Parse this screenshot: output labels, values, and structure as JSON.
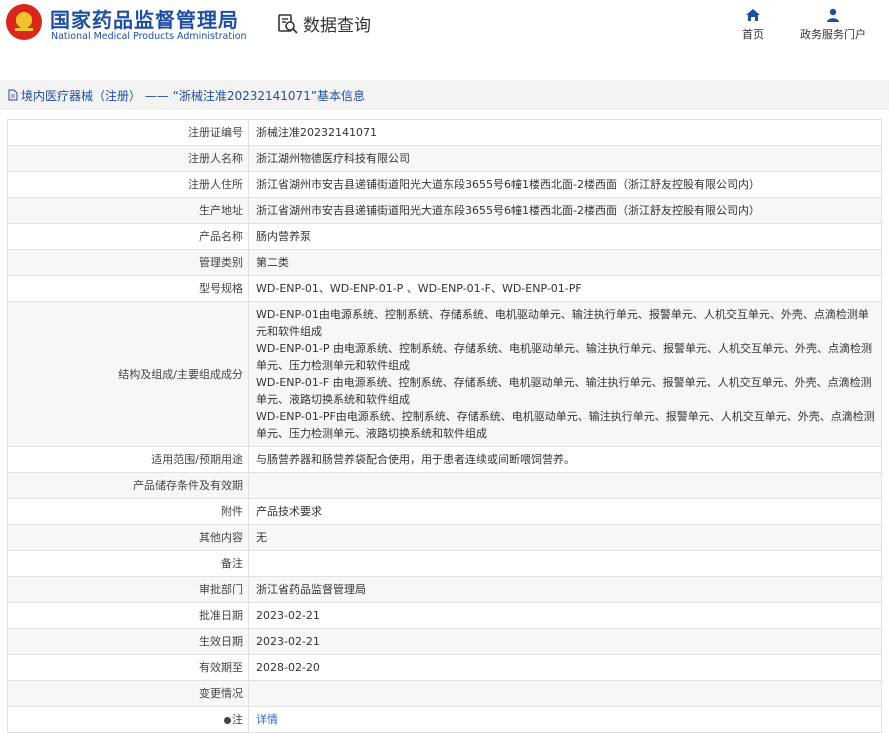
{
  "header": {
    "brand_cn": "国家药品监督管理局",
    "brand_en": "National Medical Products Administration",
    "query_label": "数据查询",
    "nav": {
      "home": "首页",
      "portal": "政务服务门户"
    },
    "colors": {
      "brand": "#1f4fa0",
      "emblem_red": "#d9271c",
      "emblem_gold": "#f3c32b"
    }
  },
  "breadcrumb": "境内医疗器械（注册） —— “浙械注准20232141071”基本信息",
  "rows": [
    {
      "label": "注册证编号",
      "value": "浙械注准20232141071"
    },
    {
      "label": "注册人名称",
      "value": "浙江湖州物德医疗科技有限公司"
    },
    {
      "label": "注册人住所",
      "value": "浙江省湖州市安吉县递铺街道阳光大道东段3655号6幢1楼西北面-2楼西面（浙江舒友控股有限公司内）"
    },
    {
      "label": "生产地址",
      "value": "浙江省湖州市安吉县递铺街道阳光大道东段3655号6幢1楼西北面-2楼西面（浙江舒友控股有限公司内）"
    },
    {
      "label": "产品名称",
      "value": "肠内营养泵"
    },
    {
      "label": "管理类别",
      "value": "第二类"
    },
    {
      "label": "型号规格",
      "value": "WD-ENP-01、WD-ENP-01-P 、WD-ENP-01-F、WD-ENP-01-PF"
    },
    {
      "label": "结构及组成/主要组成成分",
      "lines": [
        "WD-ENP-01由电源系统、控制系统、存储系统、电机驱动单元、输注执行单元、报警单元、人机交互单元、外壳、点滴检测单元和软件组成",
        "WD-ENP-01-P 由电源系统、控制系统、存储系统、电机驱动单元、输注执行单元、报警单元、人机交互单元、外壳、点滴检测单元、压力检测单元和软件组成",
        "WD-ENP-01-F 由电源系统、控制系统、存储系统、电机驱动单元、输注执行单元、报警单元、人机交互单元、外壳、点滴检测单元、液路切换系统和软件组成",
        "WD-ENP-01-PF由电源系统、控制系统、存储系统、电机驱动单元、输注执行单元、报警单元、人机交互单元、外壳、点滴检测单元、压力检测单元、液路切换系统和软件组成"
      ]
    },
    {
      "label": "适用范围/预期用途",
      "value": "与肠营养器和肠营养袋配合使用，用于患者连续或间断喂饲营养。"
    },
    {
      "label": "产品储存条件及有效期",
      "value": ""
    },
    {
      "label": "附件",
      "value": "产品技术要求"
    },
    {
      "label": "其他内容",
      "value": "无"
    },
    {
      "label": "备注",
      "value": ""
    },
    {
      "label": "审批部门",
      "value": "浙江省药品监督管理局"
    },
    {
      "label": "批准日期",
      "value": "2023-02-21"
    },
    {
      "label": "生效日期",
      "value": "2023-02-21"
    },
    {
      "label": "有效期至",
      "value": "2028-02-20"
    },
    {
      "label": "变更情况",
      "value": ""
    },
    {
      "label": "注",
      "value": "详情"
    }
  ]
}
